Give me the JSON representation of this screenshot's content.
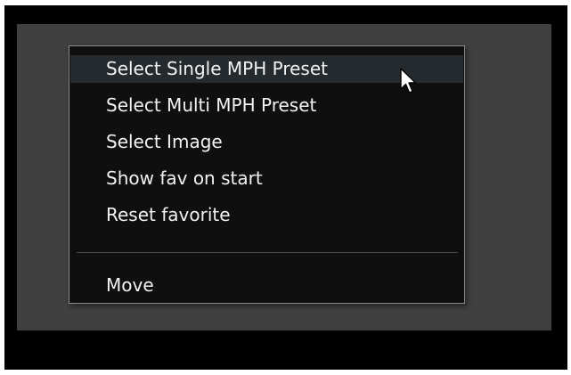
{
  "context_menu": {
    "items": [
      {
        "label": "Select Single MPH Preset",
        "hovered": true
      },
      {
        "label": "Select Multi MPH Preset"
      },
      {
        "label": "Select Image"
      },
      {
        "label": "Show fav on start"
      },
      {
        "label": "Reset favorite"
      }
    ],
    "move_label": "Move"
  },
  "pointer": {
    "icon": "arrow-cursor-icon"
  },
  "colors": {
    "frame": "#000000",
    "panel": "#404040",
    "menu_bg": "#0f0f0f",
    "menu_border": "#8a8a8a",
    "hover_bg": "#242a2d",
    "text": "#f2f2f2"
  }
}
